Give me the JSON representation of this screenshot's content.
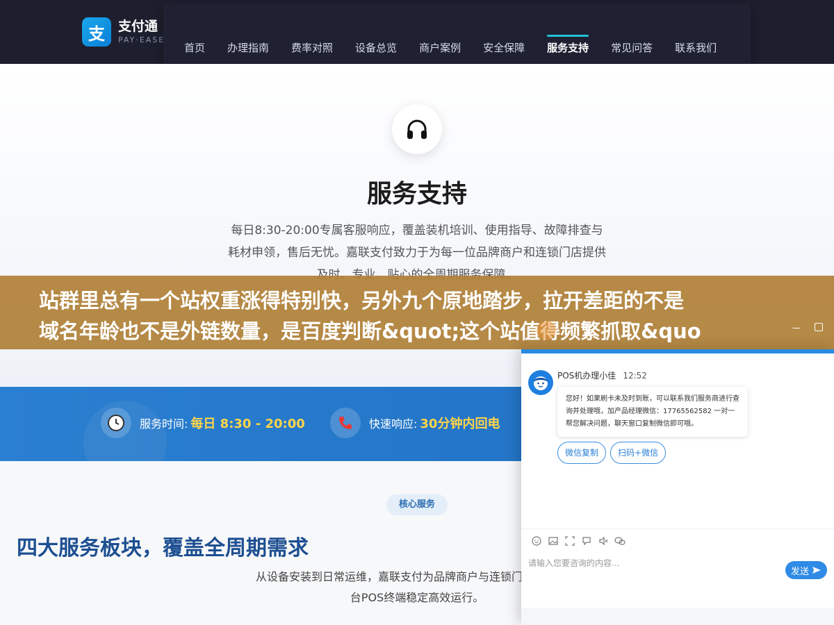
{
  "header": {
    "logo_mark": "支",
    "logo_name": "支付通",
    "logo_sub": "PAY·EASE",
    "nav": [
      {
        "label": "首页"
      },
      {
        "label": "办理指南"
      },
      {
        "label": "费率对照"
      },
      {
        "label": "设备总览"
      },
      {
        "label": "商户案例"
      },
      {
        "label": "安全保障"
      },
      {
        "label": "服务支持"
      },
      {
        "label": "常见问答"
      },
      {
        "label": "联系我们"
      }
    ],
    "active_index": 6
  },
  "hero": {
    "icon": "headset-icon",
    "title": "服务支持",
    "desc": "每日8:30-20:00专属客服响应，覆盖装机培训、使用指导、故障排查与耗材申领，售后无忧。嘉联支付致力于为每一位品牌商户和连锁门店提供及时、专业、贴心的全周期服务保障。"
  },
  "banner": {
    "line1": "站群里总有一个站权重涨得特别快，另外九个原地踏步，拉开差距的不是",
    "line2": "域名年龄也不是外链数量，是百度判断&quot;这个站值得频繁抓取&quo"
  },
  "strip": {
    "item1_label": "服务时间:",
    "item1_value": "每日 8:30 - 20:00",
    "item2_label": "快速响应:",
    "item2_value": "30分钟内回电"
  },
  "core": {
    "badge": "核心服务",
    "title": "四大服务板块，覆盖全周期需求",
    "desc_line1": "从设备安装到日常运维，嘉联支付为品牌商户与连锁门店提供系统",
    "desc_line2": "台POS终端稳定高效运行。"
  },
  "chat": {
    "agent_name": "POS机办理小佳",
    "time": "12:52",
    "message": "您好！如果刷卡未及时到账，可以联系我们服务商进行查询并处理哦，加产品经理微信：17765562582 一对一帮您解决问题，聊天窗口复制微信即可哦。",
    "quick_btn1": "微信复制",
    "quick_btn2": "扫码+微信",
    "input_placeholder": "请输入您要咨询的内容...",
    "send_label": "发送"
  },
  "colors": {
    "header_bg": "#1d1f2e",
    "accent": "#22c1d6",
    "banner_bg": "#b08038",
    "strip_bg": "#2b7fd0",
    "highlight": "#ffd54a",
    "core_title": "#1d4f91"
  }
}
